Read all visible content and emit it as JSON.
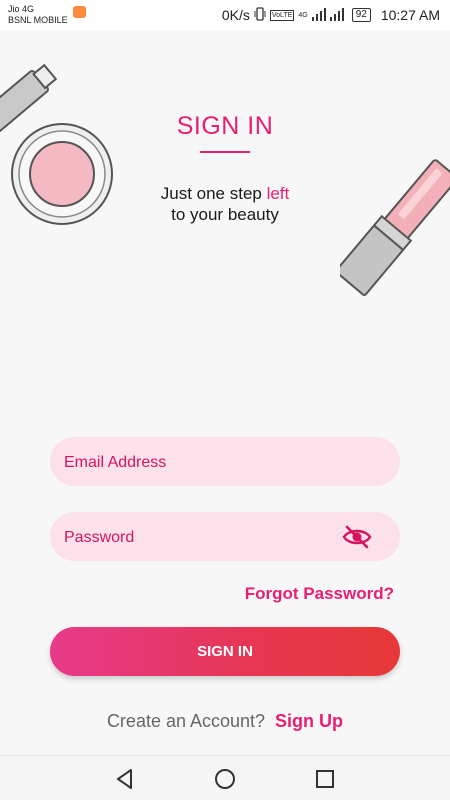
{
  "status_bar": {
    "carrier_line1": "Jio 4G",
    "carrier_line2": "BSNL MOBILE",
    "net_speed": "0K/s",
    "volte": "VoLTE",
    "net_type": "4G",
    "battery": "92",
    "time": "10:27 AM"
  },
  "header": {
    "title": "SIGN IN",
    "tagline_part1": "Just one step ",
    "tagline_highlight": "left",
    "tagline_line2": "to your beauty"
  },
  "form": {
    "email_placeholder": "Email Address",
    "email_value": "",
    "password_placeholder": "Password",
    "password_value": "",
    "forgot_label": "Forgot Password?",
    "submit_label": "SIGN IN"
  },
  "footer": {
    "account_prompt": "Create an Account?",
    "signup_label": "Sign Up"
  },
  "icons": {
    "password_toggle": "eye-slash-icon",
    "nav_back": "back-triangle-icon",
    "nav_home": "home-circle-icon",
    "nav_recent": "recent-square-icon"
  },
  "colors": {
    "accent": "#e91e72",
    "field_background": "#fce1eb",
    "button_gradient_start": "#e73a8b",
    "button_gradient_end": "#e63838",
    "background": "#f7f7f7"
  }
}
